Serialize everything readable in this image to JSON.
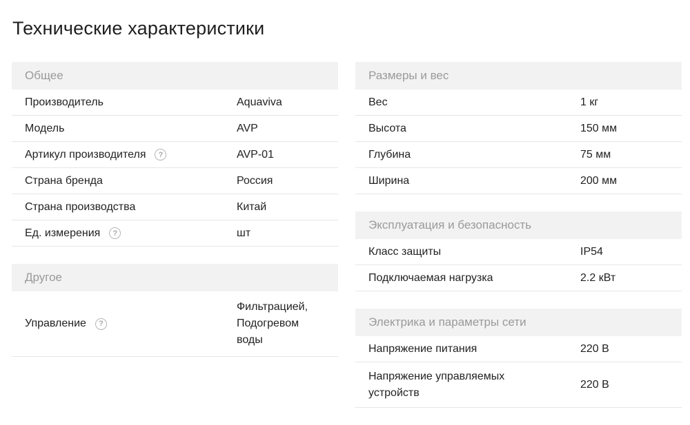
{
  "title": "Технические характеристики",
  "left": {
    "general": {
      "header": "Общее",
      "rows": [
        {
          "key": "Производитель",
          "value": "Aquaviva"
        },
        {
          "key": "Модель",
          "value": "AVP"
        },
        {
          "key": "Артикул производителя",
          "value": "AVP-01"
        },
        {
          "key": "Страна бренда",
          "value": "Россия"
        },
        {
          "key": "Страна производства",
          "value": "Китай"
        },
        {
          "key": "Ед. измерения",
          "value": "шт"
        }
      ]
    },
    "other": {
      "header": "Другое",
      "rows": [
        {
          "key": "Управление",
          "value_lines": [
            "Фильтрацией,",
            "Подогревом",
            "воды"
          ]
        }
      ]
    }
  },
  "right": {
    "size": {
      "header": "Размеры и вес",
      "rows": [
        {
          "key": "Вес",
          "value": "1 кг"
        },
        {
          "key": "Высота",
          "value": "150 мм"
        },
        {
          "key": "Глубина",
          "value": "75 мм"
        },
        {
          "key": "Ширина",
          "value": "200 мм"
        }
      ]
    },
    "operation": {
      "header": "Эксплуатация и безопасность",
      "rows": [
        {
          "key": "Класс защиты",
          "value": "IP54"
        },
        {
          "key": "Подключаемая нагрузка",
          "value": "2.2 кВт"
        }
      ]
    },
    "electrics": {
      "header": "Электрика и параметры сети",
      "rows": [
        {
          "key": "Напряжение питания",
          "value": "220 В"
        },
        {
          "key_lines": [
            "Напряжение управляемых",
            "устройств"
          ],
          "value": "220 В"
        }
      ]
    }
  },
  "help_glyph": "?"
}
